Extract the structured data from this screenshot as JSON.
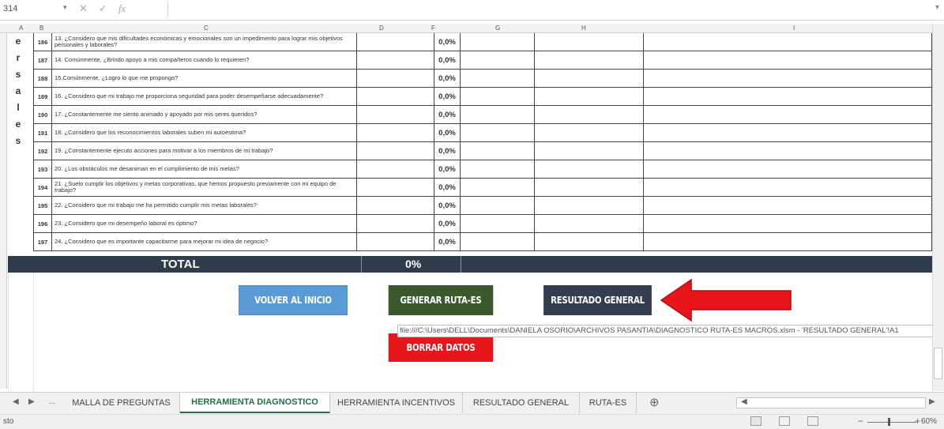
{
  "formula_bar": {
    "name_box": "314",
    "cancel_symbol": "✕",
    "enter_symbol": "✓",
    "function_symbol": "fx"
  },
  "columns": [
    "A",
    "B",
    "C",
    "D",
    "F",
    "G",
    "H",
    "I"
  ],
  "side_word_letters": [
    "e",
    "r",
    "s",
    "a",
    "l",
    "e",
    "s"
  ],
  "rows": [
    {
      "num": "186",
      "question": "13. ¿Considero que mis dificultades económicas y emocionales son un impedimento para lograr mis objetivos personales y laborales?",
      "value": "0,0%"
    },
    {
      "num": "187",
      "question": "14. Comúnmente, ¿Brindo apoyo a mis compañeros cuando lo requieren?",
      "value": "0,0%"
    },
    {
      "num": "188",
      "question": "15.Comúnmente, ¿Logro lo que me propongo?",
      "value": "0,0%"
    },
    {
      "num": "189",
      "question": "16. ¿Considero que mi trabajo me proporciona seguridad para poder desempeñarse adecuadamente?",
      "value": "0,0%"
    },
    {
      "num": "190",
      "question": "17. ¿Constantemente me siento animado y apoyado por mis seres queridos?",
      "value": "0,0%"
    },
    {
      "num": "191",
      "question": "18. ¿Considero que los reconocimientos laborales suben mi autoestima?",
      "value": "0,0%"
    },
    {
      "num": "192",
      "question": "19. ¿Constantemente ejecuto acciones para motivar a los miembros de mi trabajo?",
      "value": "0,0%"
    },
    {
      "num": "193",
      "question": "20. ¿Los obstáculos me desaniman en el cumplimiento de mis metas?",
      "value": "0,0%"
    },
    {
      "num": "194",
      "question": "21. ¿Suelo cumplir los objetivos y metas corporativas, que hemos propuesto previamente con mi equipo de trabajo?",
      "value": "0,0%"
    },
    {
      "num": "195",
      "question": "22. ¿Considero que mi trabajo me ha permitido cumplir mis metas laborales?",
      "value": "0,0%"
    },
    {
      "num": "196",
      "question": "23. ¿Considero que mi desempeño laboral es óptimo?",
      "value": "0,0%"
    },
    {
      "num": "197",
      "question": "24. ¿Considero que es importante capacitarme para mejorar mi idea de negocio?",
      "value": "0,0%"
    }
  ],
  "total": {
    "label": "TOTAL",
    "value": "0%"
  },
  "buttons": {
    "volver": "VOLVER AL INICIO",
    "generar": "GENERAR RUTA-ES",
    "resultado": "RESULTADO GENERAL",
    "borrar": "BORRAR DATOS"
  },
  "tooltip": "file:///C:\\Users\\DELL\\Documents\\DANIELA OSORIO\\ARCHIVOS PASANTIA\\DIAGNOSTICO RUTA-ES MACROS.xlsm - 'RESULTADO GENERAL'!A1",
  "sheet_tabs": [
    "MALLA DE PREGUNTAS",
    "HERRAMIENTA DIAGNOSTICO",
    "HERRAMIENTA INCENTIVOS",
    "RESULTADO GENERAL",
    "RUTA-ES"
  ],
  "tab_nav": {
    "ellipsis": "...",
    "add": "⊕"
  },
  "status": {
    "text": "sto",
    "zoom": "60%"
  },
  "colors": {
    "total_bar": "#2e3c4b",
    "volver": "#5b9bd5",
    "generar": "#3a5a2e",
    "resultado": "#333f4f",
    "borrar": "#e8151b",
    "arrow": "#e8151b",
    "active_tab": "#217346"
  }
}
